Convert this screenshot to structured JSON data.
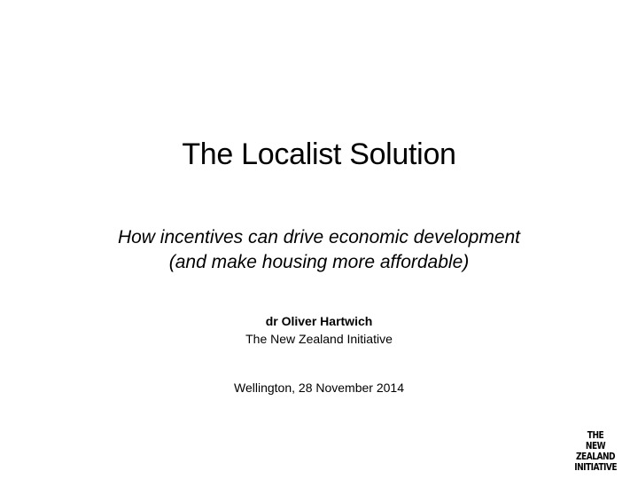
{
  "slide": {
    "title": "The Localist Solution",
    "subtitle": {
      "line1": "How incentives can drive economic development",
      "line2": "(and make housing more affordable)"
    },
    "author": {
      "name": "dr Oliver Hartwich",
      "organization": "The New Zealand Initiative"
    },
    "place_date": "Wellington, 28 November 2014",
    "logo": {
      "line1": "THE",
      "line2": "NEW ZEALAND",
      "line3": "INITIATIVE"
    }
  }
}
